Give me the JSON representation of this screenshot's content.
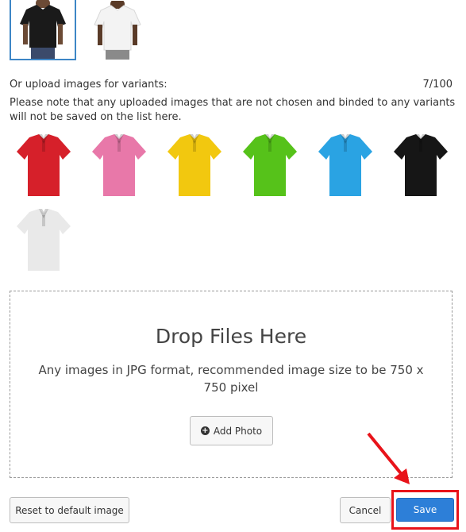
{
  "variant_thumbs": [
    {
      "name": "black-polo-model",
      "color": "#1a1a1a",
      "selected": true
    },
    {
      "name": "white-polo-model",
      "color": "#f3f3f3",
      "selected": false
    }
  ],
  "upload_section": {
    "label": "Or upload images for variants:",
    "count": "7/100",
    "note": "Please note that any uploaded images that are not chosen and binded to any variants will not be saved on the list here."
  },
  "uploaded_images": [
    {
      "name": "red-polo",
      "color": "#d6202a"
    },
    {
      "name": "pink-polo",
      "color": "#e878a9"
    },
    {
      "name": "yellow-polo",
      "color": "#f2c80f"
    },
    {
      "name": "green-polo",
      "color": "#56c21a"
    },
    {
      "name": "blue-polo",
      "color": "#2aa3e3"
    },
    {
      "name": "black-polo",
      "color": "#161616"
    },
    {
      "name": "white-polo",
      "color": "#e9e9e9"
    }
  ],
  "dropzone": {
    "title": "Drop Files Here",
    "text": "Any images in JPG format, recommended image size to be 750 x 750 pixel",
    "add_photo_label": "Add Photo"
  },
  "footer": {
    "reset_label": "Reset to default image",
    "cancel_label": "Cancel",
    "save_label": "Save"
  },
  "colors": {
    "accent": "#2d7fd8",
    "highlight": "#e8131a",
    "selected_border": "#3d86c6"
  }
}
